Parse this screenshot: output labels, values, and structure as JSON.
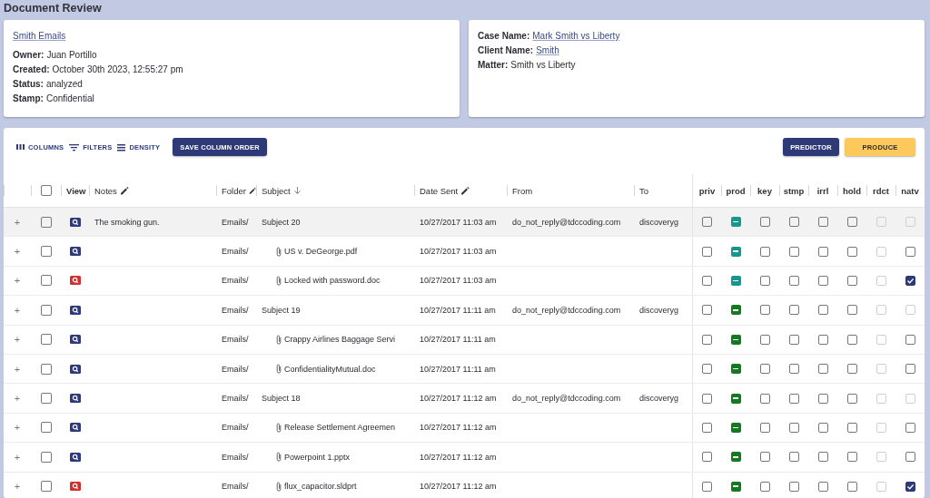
{
  "page": {
    "title": "Document Review"
  },
  "info_card": {
    "link": "Smith Emails",
    "fields": [
      {
        "label": "Owner:",
        "value": "Juan Portillo",
        "link": false
      },
      {
        "label": "Created:",
        "value": "October 30th 2023, 12:55:27 pm",
        "link": false
      },
      {
        "label": "Status:",
        "value": "analyzed",
        "link": false
      },
      {
        "label": "Stamp:",
        "value": "Confidential",
        "link": false
      }
    ]
  },
  "case_card": {
    "fields": [
      {
        "label": "Case Name:",
        "value": "Mark Smith vs Liberty",
        "link": true
      },
      {
        "label": "Client Name:",
        "value": "Smith",
        "link": true
      },
      {
        "label": "Matter:",
        "value": "Smith vs Liberty",
        "link": false
      }
    ]
  },
  "toolbar": {
    "tools": [
      {
        "kind": "columns",
        "label": "COLUMNS"
      },
      {
        "kind": "filters",
        "label": "FILTERS"
      },
      {
        "kind": "density",
        "label": "DENSITY"
      }
    ],
    "buttons": [
      {
        "label": "SAVE COLUMN ORDER",
        "kind": "primary"
      }
    ],
    "right_buttons": [
      {
        "label": "PREDICTOR",
        "kind": "primary"
      },
      {
        "label": "PRODUCE",
        "kind": "accent"
      }
    ]
  },
  "table": {
    "header_checkbox": {
      "checked": false
    },
    "columns": [
      {
        "label": "View"
      },
      {
        "label": "Notes",
        "editable": true
      },
      {
        "label": "Folder",
        "editable": true
      },
      {
        "label": "Subject",
        "sorted_descending": true
      },
      {
        "label": "Date Sent",
        "editable": true
      },
      {
        "label": "From"
      },
      {
        "label": "To"
      }
    ],
    "flag_columns": [
      "priv",
      "prod",
      "key",
      "stmp",
      "irrl",
      "hold",
      "rdct",
      "natv"
    ],
    "rows": [
      {
        "expand": "+",
        "checked": false,
        "highlighted": true,
        "view": {
          "color": "#2e3a7c"
        },
        "notes": "The smoking gun.",
        "folder": "Emails/",
        "subject": "Subject 20",
        "attachment": false,
        "date_sent": "10/27/2017 11:03 am",
        "from": "do_not_reply@tdccoding.com",
        "to": "discoveryg",
        "flags": [
          {
            "checked": false,
            "disabled": false
          },
          {
            "partial": true,
            "color": "#15968e"
          },
          {
            "checked": false,
            "disabled": false
          },
          {
            "checked": false,
            "disabled": false
          },
          {
            "checked": false,
            "disabled": false
          },
          {
            "checked": false,
            "disabled": false
          },
          {
            "checked": false,
            "disabled": true
          },
          {
            "checked": false,
            "disabled": true
          }
        ]
      },
      {
        "expand": "+",
        "checked": false,
        "highlighted": false,
        "view": {
          "color": "#2e3a7c"
        },
        "folder": "Emails/",
        "subject": "US v. DeGeorge.pdf",
        "attachment": true,
        "date_sent": "10/27/2017 11:03 am",
        "flags": [
          {
            "checked": false,
            "disabled": false
          },
          {
            "partial": true,
            "color": "#15968e"
          },
          {
            "checked": false,
            "disabled": false
          },
          {
            "checked": false,
            "disabled": false
          },
          {
            "checked": false,
            "disabled": false
          },
          {
            "checked": false,
            "disabled": false
          },
          {
            "checked": false,
            "disabled": true
          },
          {
            "checked": false,
            "disabled": false
          }
        ]
      },
      {
        "expand": "+",
        "checked": false,
        "highlighted": false,
        "view": {
          "color": "#d32f2f"
        },
        "folder": "Emails/",
        "subject": "Locked with password.doc",
        "attachment": true,
        "date_sent": "10/27/2017 11:03 am",
        "flags": [
          {
            "checked": false,
            "disabled": false
          },
          {
            "partial": true,
            "color": "#15968e"
          },
          {
            "checked": false,
            "disabled": false
          },
          {
            "checked": false,
            "disabled": false
          },
          {
            "checked": false,
            "disabled": false
          },
          {
            "checked": false,
            "disabled": false
          },
          {
            "checked": false,
            "disabled": true
          },
          {
            "checked": true,
            "disabled": false
          }
        ]
      },
      {
        "expand": "+",
        "checked": false,
        "highlighted": false,
        "view": {
          "color": "#2e3a7c"
        },
        "folder": "Emails/",
        "subject": "Subject 19",
        "attachment": false,
        "date_sent": "10/27/2017 11:11 am",
        "from": "do_not_reply@tdccoding.com",
        "to": "discoveryg",
        "flags": [
          {
            "checked": false,
            "disabled": false
          },
          {
            "partial": true,
            "color": "#137a1f"
          },
          {
            "checked": false,
            "disabled": false
          },
          {
            "checked": false,
            "disabled": false
          },
          {
            "checked": false,
            "disabled": false
          },
          {
            "checked": false,
            "disabled": false
          },
          {
            "checked": false,
            "disabled": true
          },
          {
            "checked": false,
            "disabled": true
          }
        ]
      },
      {
        "expand": "+",
        "checked": false,
        "highlighted": false,
        "view": {
          "color": "#2e3a7c"
        },
        "folder": "Emails/",
        "subject": "Crappy Airlines Baggage Servi",
        "attachment": true,
        "date_sent": "10/27/2017 11:11 am",
        "flags": [
          {
            "checked": false,
            "disabled": false
          },
          {
            "partial": true,
            "color": "#137a1f"
          },
          {
            "checked": false,
            "disabled": false
          },
          {
            "checked": false,
            "disabled": false
          },
          {
            "checked": false,
            "disabled": false
          },
          {
            "checked": false,
            "disabled": false
          },
          {
            "checked": false,
            "disabled": true
          },
          {
            "checked": false,
            "disabled": false
          }
        ]
      },
      {
        "expand": "+",
        "checked": false,
        "highlighted": false,
        "view": {
          "color": "#2e3a7c"
        },
        "folder": "Emails/",
        "subject": "ConfidentialityMutual.doc",
        "attachment": true,
        "date_sent": "10/27/2017 11:11 am",
        "flags": [
          {
            "checked": false,
            "disabled": false
          },
          {
            "partial": true,
            "color": "#137a1f"
          },
          {
            "checked": false,
            "disabled": false
          },
          {
            "checked": false,
            "disabled": false
          },
          {
            "checked": false,
            "disabled": false
          },
          {
            "checked": false,
            "disabled": false
          },
          {
            "checked": false,
            "disabled": true
          },
          {
            "checked": false,
            "disabled": false
          }
        ]
      },
      {
        "expand": "+",
        "checked": false,
        "highlighted": false,
        "view": {
          "color": "#2e3a7c"
        },
        "folder": "Emails/",
        "subject": "Subject 18",
        "attachment": false,
        "date_sent": "10/27/2017 11:12 am",
        "from": "do_not_reply@tdccoding.com",
        "to": "discoveryg",
        "flags": [
          {
            "checked": false,
            "disabled": false
          },
          {
            "partial": true,
            "color": "#137a1f"
          },
          {
            "checked": false,
            "disabled": false
          },
          {
            "checked": false,
            "disabled": false
          },
          {
            "checked": false,
            "disabled": false
          },
          {
            "checked": false,
            "disabled": false
          },
          {
            "checked": false,
            "disabled": true
          },
          {
            "checked": false,
            "disabled": true
          }
        ]
      },
      {
        "expand": "+",
        "checked": false,
        "highlighted": false,
        "view": {
          "color": "#2e3a7c"
        },
        "folder": "Emails/",
        "subject": "Release Settlement Agreemen",
        "attachment": true,
        "date_sent": "10/27/2017 11:12 am",
        "flags": [
          {
            "checked": false,
            "disabled": false
          },
          {
            "partial": true,
            "color": "#137a1f"
          },
          {
            "checked": false,
            "disabled": false
          },
          {
            "checked": false,
            "disabled": false
          },
          {
            "checked": false,
            "disabled": false
          },
          {
            "checked": false,
            "disabled": false
          },
          {
            "checked": false,
            "disabled": true
          },
          {
            "checked": false,
            "disabled": false
          }
        ]
      },
      {
        "expand": "+",
        "checked": false,
        "highlighted": false,
        "view": {
          "color": "#2e3a7c"
        },
        "folder": "Emails/",
        "subject": "Powerpoint 1.pptx",
        "attachment": true,
        "date_sent": "10/27/2017 11:12 am",
        "flags": [
          {
            "checked": false,
            "disabled": false
          },
          {
            "partial": true,
            "color": "#137a1f"
          },
          {
            "checked": false,
            "disabled": false
          },
          {
            "checked": false,
            "disabled": false
          },
          {
            "checked": false,
            "disabled": false
          },
          {
            "checked": false,
            "disabled": false
          },
          {
            "checked": false,
            "disabled": true
          },
          {
            "checked": false,
            "disabled": false
          }
        ]
      },
      {
        "expand": "+",
        "checked": false,
        "highlighted": false,
        "view": {
          "color": "#d32f2f"
        },
        "folder": "Emails/",
        "subject": "flux_capacitor.sldprt",
        "attachment": true,
        "date_sent": "10/27/2017 11:12 am",
        "flags": [
          {
            "checked": false,
            "disabled": false
          },
          {
            "partial": true,
            "color": "#137a1f"
          },
          {
            "checked": false,
            "disabled": false
          },
          {
            "checked": false,
            "disabled": false
          },
          {
            "checked": false,
            "disabled": false
          },
          {
            "checked": false,
            "disabled": false
          },
          {
            "checked": false,
            "disabled": true
          },
          {
            "checked": true,
            "disabled": false
          }
        ]
      }
    ]
  }
}
